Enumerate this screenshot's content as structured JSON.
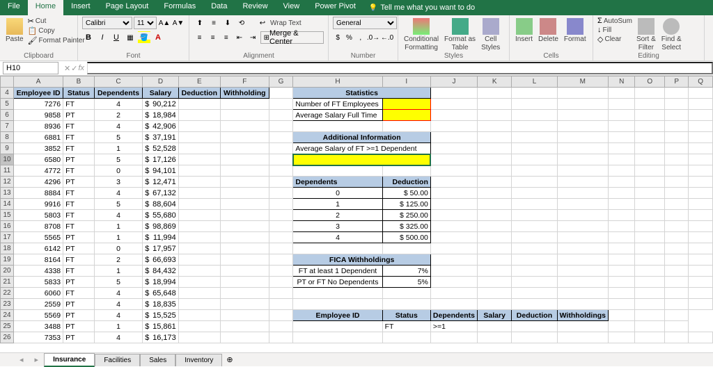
{
  "tabs": {
    "file": "File",
    "home": "Home",
    "insert": "Insert",
    "pagelayout": "Page Layout",
    "formulas": "Formulas",
    "data": "Data",
    "review": "Review",
    "view": "View",
    "powerpivot": "Power Pivot",
    "tellme": "Tell me what you want to do"
  },
  "ribbon": {
    "clipboard": {
      "label": "Clipboard",
      "paste": "Paste",
      "cut": "Cut",
      "copy": "Copy",
      "painter": "Format Painter"
    },
    "font": {
      "label": "Font",
      "name": "Calibri",
      "size": "11"
    },
    "alignment": {
      "label": "Alignment",
      "wrap": "Wrap Text",
      "merge": "Merge & Center"
    },
    "number": {
      "label": "Number",
      "format": "General"
    },
    "styles": {
      "label": "Styles",
      "cond": "Conditional",
      "cond2": "Formatting",
      "fmt": "Format as",
      "fmt2": "Table",
      "cell": "Cell",
      "cell2": "Styles"
    },
    "cells": {
      "label": "Cells",
      "insert": "Insert",
      "delete": "Delete",
      "format": "Format"
    },
    "editing": {
      "label": "Editing",
      "autosum": "AutoSum",
      "fill": "Fill",
      "clear": "Clear",
      "sort": "Sort &",
      "sort2": "Filter",
      "find": "Find &",
      "find2": "Select"
    }
  },
  "namebox": "H10",
  "cols": [
    "A",
    "B",
    "C",
    "D",
    "E",
    "F",
    "G",
    "H",
    "I",
    "J",
    "K",
    "L",
    "M",
    "N",
    "O",
    "P",
    "Q"
  ],
  "headers": {
    "a": "Employee ID",
    "b": "Status",
    "c": "Dependents",
    "d": "Salary",
    "e": "Deduction",
    "f": "Withholding"
  },
  "rows": [
    {
      "r": 5,
      "a": "7276",
      "b": "FT",
      "c": "4",
      "d": "90,212"
    },
    {
      "r": 6,
      "a": "9858",
      "b": "PT",
      "c": "2",
      "d": "18,984"
    },
    {
      "r": 7,
      "a": "8936",
      "b": "FT",
      "c": "4",
      "d": "42,906"
    },
    {
      "r": 8,
      "a": "6881",
      "b": "FT",
      "c": "5",
      "d": "37,191"
    },
    {
      "r": 9,
      "a": "3852",
      "b": "FT",
      "c": "1",
      "d": "52,528"
    },
    {
      "r": 10,
      "a": "6580",
      "b": "PT",
      "c": "5",
      "d": "17,126"
    },
    {
      "r": 11,
      "a": "4772",
      "b": "FT",
      "c": "0",
      "d": "94,101"
    },
    {
      "r": 12,
      "a": "4296",
      "b": "PT",
      "c": "3",
      "d": "12,471"
    },
    {
      "r": 13,
      "a": "8884",
      "b": "FT",
      "c": "4",
      "d": "67,132"
    },
    {
      "r": 14,
      "a": "9916",
      "b": "FT",
      "c": "5",
      "d": "88,604"
    },
    {
      "r": 15,
      "a": "5803",
      "b": "FT",
      "c": "4",
      "d": "55,680"
    },
    {
      "r": 16,
      "a": "8708",
      "b": "FT",
      "c": "1",
      "d": "98,869"
    },
    {
      "r": 17,
      "a": "5565",
      "b": "PT",
      "c": "1",
      "d": "11,994"
    },
    {
      "r": 18,
      "a": "6142",
      "b": "PT",
      "c": "0",
      "d": "17,957"
    },
    {
      "r": 19,
      "a": "8164",
      "b": "FT",
      "c": "2",
      "d": "66,693"
    },
    {
      "r": 20,
      "a": "4338",
      "b": "FT",
      "c": "1",
      "d": "84,432"
    },
    {
      "r": 21,
      "a": "5833",
      "b": "PT",
      "c": "5",
      "d": "18,994"
    },
    {
      "r": 22,
      "a": "6060",
      "b": "FT",
      "c": "4",
      "d": "65,648"
    },
    {
      "r": 23,
      "a": "2559",
      "b": "PT",
      "c": "4",
      "d": "18,835"
    },
    {
      "r": 24,
      "a": "5569",
      "b": "PT",
      "c": "4",
      "d": "15,525"
    },
    {
      "r": 25,
      "a": "3488",
      "b": "PT",
      "c": "1",
      "d": "15,861"
    },
    {
      "r": 26,
      "a": "7353",
      "b": "PT",
      "c": "4",
      "d": "16,173"
    }
  ],
  "stats": {
    "title": "Statistics",
    "r1": "Number of FT Employees",
    "r2": "Average Salary Full Time"
  },
  "addl": {
    "title": "Additional Information",
    "r1": "Average Salary of FT >=1 Dependent"
  },
  "dep": {
    "h1": "Dependents",
    "h2": "Deduction",
    "rows": [
      {
        "d": "0",
        "v": "$    50.00"
      },
      {
        "d": "1",
        "v": "$  125.00"
      },
      {
        "d": "2",
        "v": "$  250.00"
      },
      {
        "d": "3",
        "v": "$  325.00"
      },
      {
        "d": "4",
        "v": "$  500.00"
      }
    ]
  },
  "fica": {
    "title": "FICA Withholdings",
    "r1": "FT at least 1 Dependent",
    "v1": "7%",
    "r2": "PT or FT No Dependents",
    "v2": "5%"
  },
  "crit": {
    "h1": "Employee ID",
    "h2": "Status",
    "h3": "Dependents",
    "h4": "Salary",
    "h5": "Deduction",
    "h6": "Withholdings",
    "v2": "FT",
    "v3": ">=1"
  },
  "sheets": {
    "s1": "Insurance",
    "s2": "Facilities",
    "s3": "Sales",
    "s4": "Inventory"
  },
  "dollar": "$"
}
